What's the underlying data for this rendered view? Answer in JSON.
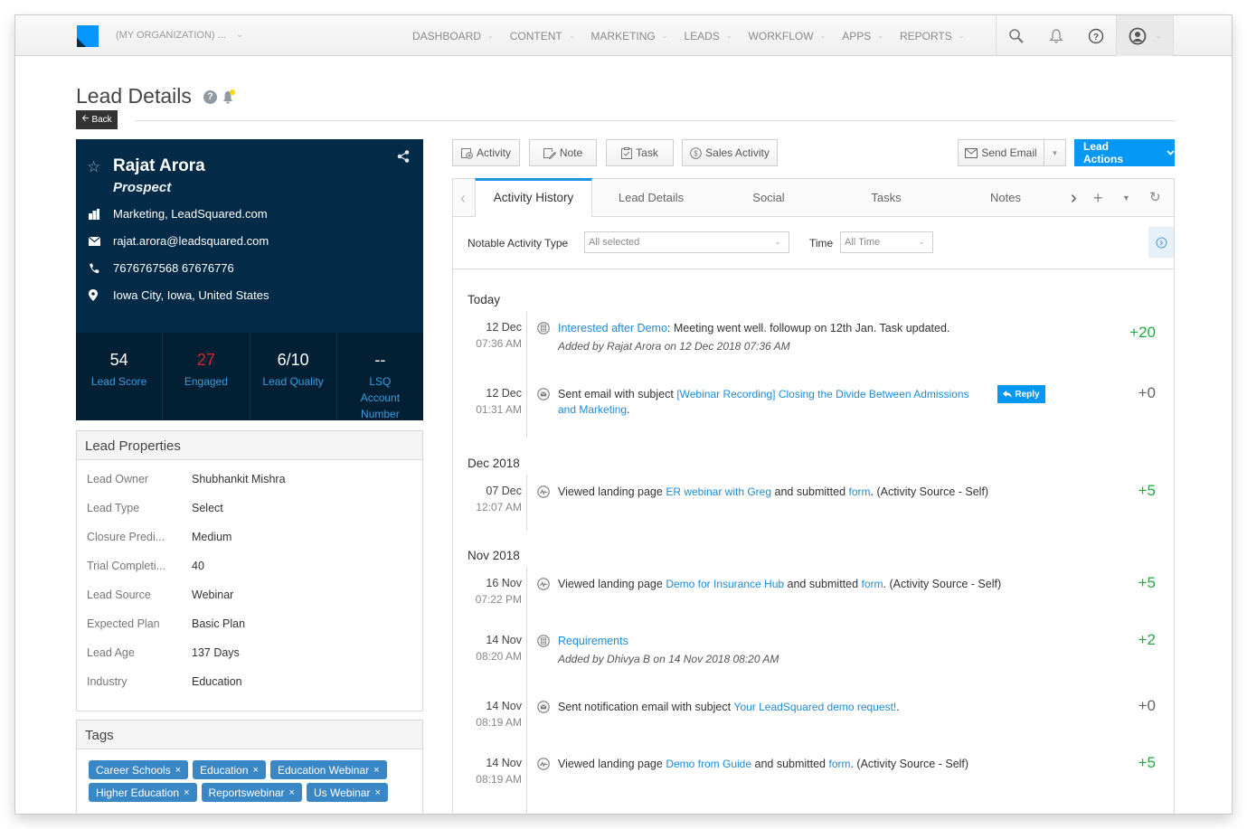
{
  "topnav": {
    "org_label": "(MY ORGANIZATION) ...",
    "menu": [
      {
        "label": "DASHBOARD"
      },
      {
        "label": "CONTENT"
      },
      {
        "label": "MARKETING"
      },
      {
        "label": "LEADS"
      },
      {
        "label": "WORKFLOW"
      },
      {
        "label": "APPS"
      },
      {
        "label": "REPORTS"
      }
    ],
    "icons": [
      "search-icon",
      "bell-icon",
      "help-icon",
      "user-icon"
    ]
  },
  "page": {
    "title": "Lead Details",
    "back_label": "Back"
  },
  "lead": {
    "name": "Rajat Arora",
    "stage": "Prospect",
    "company": "Marketing, LeadSquared.com",
    "email": "rajat.arora@leadsquared.com",
    "phone": "7676767568 67676776",
    "location": "Iowa City, Iowa, United States",
    "stats": [
      {
        "value": "54",
        "label": "Lead Score"
      },
      {
        "value": "27",
        "label": "Engaged"
      },
      {
        "value": "6/10",
        "label": "Lead Quality"
      },
      {
        "value": "--",
        "label": "LSQ Account Number"
      }
    ]
  },
  "properties": {
    "title": "Lead Properties",
    "rows": [
      {
        "key": "Lead Owner",
        "value": "Shubhankit Mishra"
      },
      {
        "key": "Lead Type",
        "value": "Select"
      },
      {
        "key": "Closure Predi...",
        "value": "Medium"
      },
      {
        "key": "Trial Completi...",
        "value": "40"
      },
      {
        "key": "Lead Source",
        "value": "Webinar"
      },
      {
        "key": "Expected Plan",
        "value": "Basic Plan"
      },
      {
        "key": "Lead Age",
        "value": "137 Days"
      },
      {
        "key": "Industry",
        "value": "Education"
      }
    ]
  },
  "tags": {
    "title": "Tags",
    "items": [
      "Career Schools",
      "Education",
      "Education Webinar",
      "Higher Education",
      "Reportswebinar",
      "Us Webinar"
    ],
    "remove_glyph": "×"
  },
  "actions": {
    "activity": "Activity",
    "note": "Note",
    "task": "Task",
    "sales_activity": "Sales Activity",
    "send_email": "Send Email",
    "lead_actions": "Lead Actions"
  },
  "tabs": {
    "items": [
      "Activity History",
      "Lead Details",
      "Social",
      "Tasks",
      "Notes"
    ],
    "active": "Activity History"
  },
  "filters": {
    "type_label": "Notable Activity Type",
    "type_value": "All selected",
    "time_label": "Time",
    "time_value": "All Time"
  },
  "timeline": {
    "groups": [
      {
        "label": "Today"
      },
      {
        "label": "Dec 2018"
      },
      {
        "label": "Nov 2018"
      }
    ],
    "entries": [
      {
        "date": "12 Dec",
        "time": "07:36 AM",
        "icon": "note-icon",
        "link": "Interested after Demo",
        "text": ": Meeting went well. followup on 12th Jan. Task updated.",
        "sub": "Added by Rajat Arora on 12 Dec 2018 07:36 AM",
        "score": "+20"
      },
      {
        "date": "12 Dec",
        "time": "01:31 AM",
        "icon": "email-icon",
        "pre": "Sent email with subject ",
        "link": "[Webinar Recording] Closing the Divide Between Admissions and Marketing",
        "post": ".",
        "reply": "Reply",
        "score": "+0"
      },
      {
        "date": "07 Dec",
        "time": "12:07 AM",
        "icon": "pulse-icon",
        "pre": "Viewed landing page ",
        "link": "ER webinar with Greg",
        "mid": " and submitted ",
        "link2": "form",
        "post": ". (Activity Source - Self)",
        "score": "+5"
      },
      {
        "date": "16 Nov",
        "time": "07:22 PM",
        "icon": "pulse-icon",
        "pre": "Viewed landing page ",
        "link": "Demo for Insurance Hub",
        "mid": " and submitted ",
        "link2": "form",
        "post": ". (Activity Source - Self)",
        "score": "+5"
      },
      {
        "date": "14 Nov",
        "time": "08:20 AM",
        "icon": "note-icon",
        "link": "Requirements",
        "sub": "Added by Dhivya B on 14 Nov 2018 08:20 AM",
        "score": "+2"
      },
      {
        "date": "14 Nov",
        "time": "08:19 AM",
        "icon": "email-icon",
        "pre": "Sent notification email with subject ",
        "link": "Your LeadSquared demo request!",
        "post": ".",
        "score": "+0"
      },
      {
        "date": "14 Nov",
        "time": "08:19 AM",
        "icon": "pulse-icon",
        "pre": "Viewed landing page ",
        "link": "Demo from Guide",
        "mid": " and submitted ",
        "link2": "form",
        "post": ". (Activity Source - Self)",
        "score": "+5"
      }
    ]
  },
  "colors": {
    "brand_blue": "#0797f5",
    "card_navy": "#032b47",
    "tag_blue": "#3a87c6",
    "link_blue": "#1e8bd6",
    "score_green": "#27a744",
    "engaged_red": "#d0282d"
  }
}
